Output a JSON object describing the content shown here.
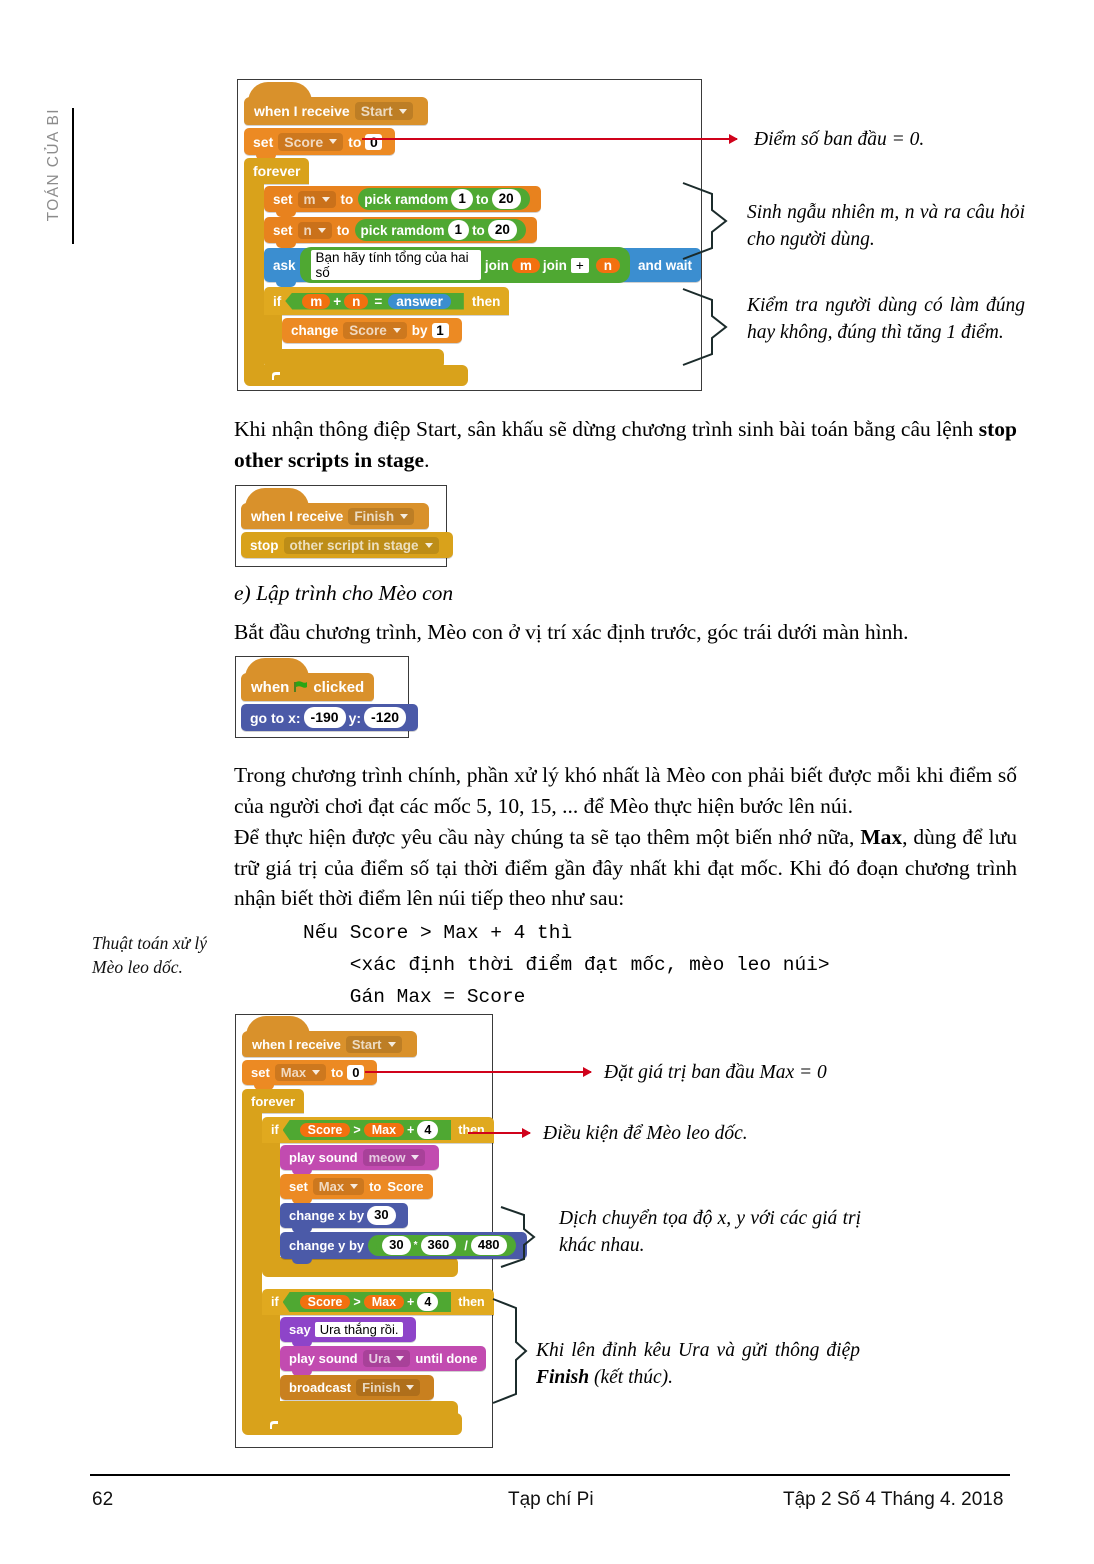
{
  "running_head": "TOÁN CỦA BI",
  "margin_note": "Thuật toán xử lý Mèo leo dốc.",
  "figure1": {
    "blocks": {
      "when_i_receive": "when I receive",
      "msg_start": "Start",
      "set": "set",
      "var_score": "Score",
      "to": "to",
      "zero": "0",
      "forever": "forever",
      "var_m": "m",
      "var_n": "n",
      "pick_random": "pick ramdom",
      "rand_from": "1",
      "rand_to_label": "to",
      "rand_to": "20",
      "ask": "ask",
      "question_text": "Bạn hãy tính tổng của hai số",
      "join1": "join",
      "join2": "join",
      "plus_sign": "+",
      "and_wait": "and wait",
      "if": "if",
      "then": "then",
      "op_plus": "+",
      "op_eq": "=",
      "answer": "answer",
      "change": "change",
      "by": "by",
      "one": "1"
    },
    "annotations": [
      "Điểm số ban đầu = 0.",
      "Sinh ngẫu nhiên m, n và ra câu hỏi cho người dùng.",
      "Kiểm tra người dùng có làm đúng hay không, đúng thì tăng 1 điểm."
    ]
  },
  "para1": {
    "lead": "Khi nhận thông điệp Start, sân khấu sẽ dừng chương trình sinh bài toán bằng câu lệnh ",
    "bold": "stop other scripts in stage",
    "tail": "."
  },
  "figure2": {
    "when_i_receive": "when I receive",
    "msg_finish": "Finish",
    "stop": "stop",
    "stop_target": "other script in stage"
  },
  "heading_e": "e) Lập trình cho Mèo con",
  "para2": "Bắt đầu chương trình, Mèo con ở vị trí xác định trước, góc trái dưới màn hình.",
  "figure3": {
    "when": "when",
    "clicked": "clicked",
    "go_to": "go to x:",
    "x_value": "-190",
    "y_label": "y:",
    "y_value": "-120"
  },
  "para3": "Trong chương trình chính, phần xử lý khó nhất là Mèo con phải biết được mỗi khi điểm số của người chơi đạt các mốc 5, 10, 15, ... để Mèo thực hiện bước lên núi.",
  "para4": {
    "part1": "Để thực hiện được yêu cầu này chúng ta sẽ tạo thêm một biến nhớ nữa, ",
    "bold": "Max",
    "part2": ", dùng để lưu trữ giá trị của điểm số tại thời điểm gần đây nhất khi đạt mốc. Khi đó đoạn chương trình nhận biết thời điểm lên núi tiếp theo như sau:"
  },
  "pseudocode": {
    "line1": "Nếu Score > Max + 4 thì",
    "line2": "    <xác định thời điểm đạt mốc, mèo leo núi>",
    "line3": "    Gán Max = Score"
  },
  "figure4": {
    "blocks": {
      "when_i_receive": "when I receive",
      "msg_start": "Start",
      "set": "set",
      "var_max": "Max",
      "to": "to",
      "zero": "0",
      "forever": "forever",
      "if": "if",
      "then": "then",
      "var_score": "Score",
      "op_gt": ">",
      "op_plus": "+",
      "four": "4",
      "play_sound": "play sound",
      "sound_meow": "meow",
      "change_x_by": "change x by",
      "x_step": "30",
      "change_y_by": "change y by",
      "y_a": "30",
      "op_mul": "*",
      "y_b": "360",
      "op_div": "/",
      "y_c": "480",
      "say": "say",
      "say_text": "Ura thắng rồi.",
      "play_sound_until": "play sound",
      "sound_ura": "Ura",
      "until_done": "until done",
      "broadcast": "broadcast",
      "msg_finish": "Finish"
    },
    "annotations": [
      "Đặt giá trị ban đầu Max = 0",
      "Điều kiện để Mèo leo dốc.",
      "Dịch chuyển tọa độ x, y với các giá trị khác nhau.",
      {
        "part1": "Khi lên đỉnh kêu Ura và gửi thông điệp ",
        "bold": "Finish",
        "part2": " (kết thúc)."
      }
    ]
  },
  "footer": {
    "page_number": "62",
    "journal": "Tạp chí Pi",
    "issue": "Tập 2 Số 4 Tháng 4. 2018"
  },
  "colors": {
    "accent_red": "#d0021b",
    "events_orange": "#d9912b",
    "variables_orange": "#ec8a23",
    "control_gold": "#d9a21b",
    "sensing_blue": "#3b8ed0",
    "operators_green": "#4fa832",
    "sound_purple": "#c24bb0",
    "motion_blue": "#4b5aa8",
    "looks_purple": "#8e44c9"
  }
}
